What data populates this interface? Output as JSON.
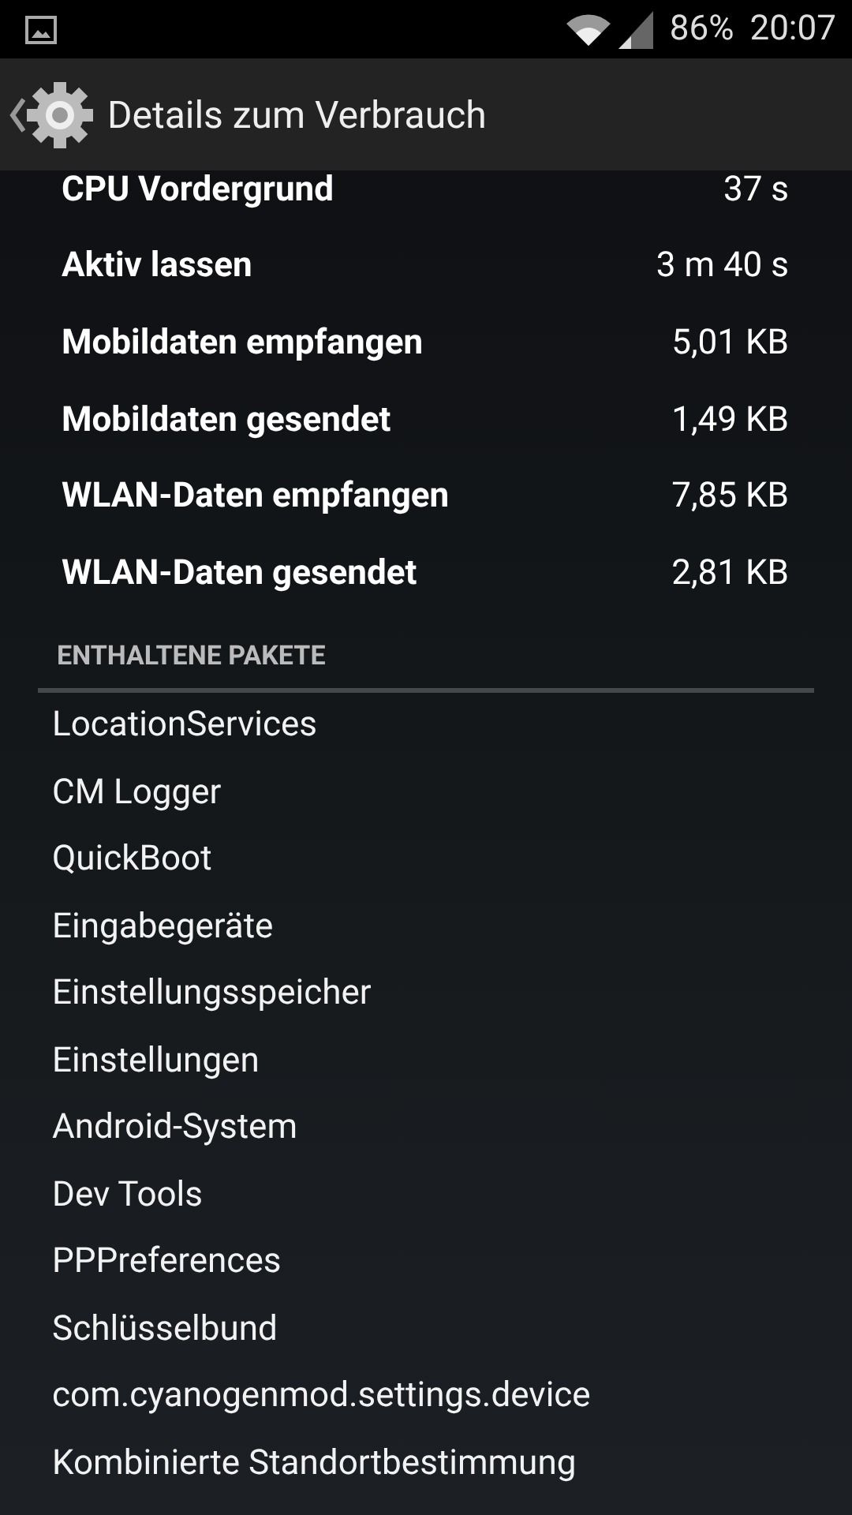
{
  "status_bar": {
    "battery": "86%",
    "time": "20:07"
  },
  "action_bar": {
    "title": "Details zum Verbrauch"
  },
  "stats": [
    {
      "label": "CPU Vordergrund",
      "value": "37 s"
    },
    {
      "label": "Aktiv lassen",
      "value": "3 m 40 s"
    },
    {
      "label": "Mobildaten empfangen",
      "value": "5,01 KB"
    },
    {
      "label": "Mobildaten gesendet",
      "value": "1,49 KB"
    },
    {
      "label": "WLAN-Daten empfangen",
      "value": "7,85 KB"
    },
    {
      "label": "WLAN-Daten gesendet",
      "value": "2,81 KB"
    }
  ],
  "packages": {
    "heading": "ENTHALTENE PAKETE",
    "items": [
      "LocationServices",
      "CM Logger",
      "QuickBoot",
      "Eingabegeräte",
      "Einstellungsspeicher",
      "Einstellungen",
      "Android-System",
      "Dev Tools",
      "PPPreferences",
      "Schlüsselbund",
      "com.cyanogenmod.settings.device",
      "Kombinierte Standortbestimmung"
    ]
  }
}
